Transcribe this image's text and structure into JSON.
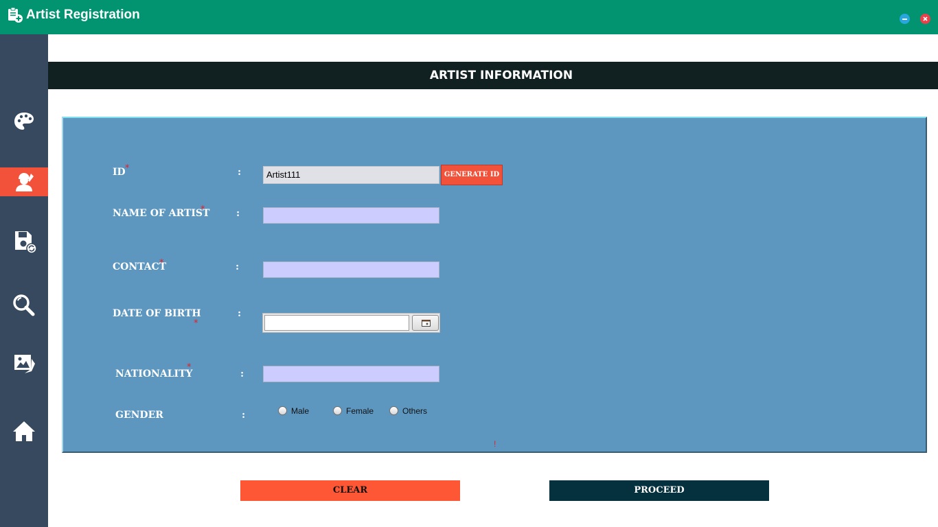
{
  "window": {
    "title": "Artist Registration",
    "title_icon": "clipboard-add-icon",
    "minimize_icon": "minimize-icon",
    "close_icon": "close-icon"
  },
  "sidebar": {
    "items": [
      {
        "icon": "palette-icon",
        "active": false
      },
      {
        "icon": "artist-icon",
        "active": true
      },
      {
        "icon": "save-update-icon",
        "active": false
      },
      {
        "icon": "search-icon",
        "active": false
      },
      {
        "icon": "gallery-icon",
        "active": false
      },
      {
        "icon": "home-icon",
        "active": false
      }
    ]
  },
  "header": {
    "title": "ARTIST INFORMATION"
  },
  "form": {
    "required_marker": "*",
    "colon": ":",
    "id": {
      "label": "ID",
      "value": "Artist111",
      "button": "GENERATE ID"
    },
    "name": {
      "label": "NAME OF ARTIST",
      "value": ""
    },
    "contact": {
      "label": "CONTACT",
      "value": ""
    },
    "dob": {
      "label": "DATE OF BIRTH",
      "value": "",
      "icon": "calendar-icon"
    },
    "nationality": {
      "label": "NATIONALITY",
      "value": ""
    },
    "gender": {
      "label": "GENDER",
      "options": [
        "Male",
        "Female",
        "Others"
      ],
      "selected": null
    },
    "error_text": "!"
  },
  "actions": {
    "clear": "CLEAR",
    "proceed": "PROCEED"
  },
  "colors": {
    "titlebar": "#029471",
    "sidebar": "#36495e",
    "accent": "#f2513a",
    "header": "#112020",
    "panel": "#5d97c0",
    "field": "#ccccff",
    "proceed": "#05313f"
  }
}
